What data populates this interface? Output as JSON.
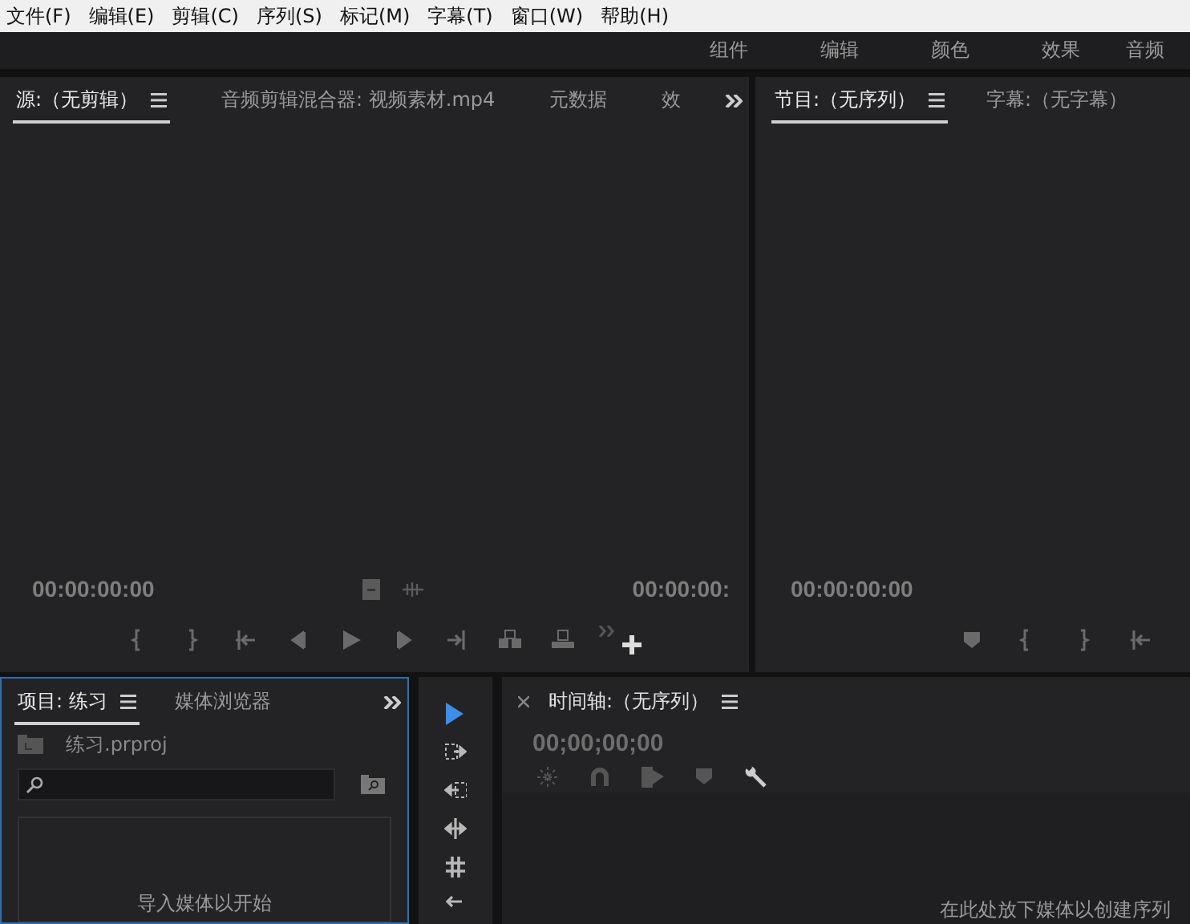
{
  "menu": [
    "文件(F)",
    "编辑(E)",
    "剪辑(C)",
    "序列(S)",
    "标记(M)",
    "字幕(T)",
    "窗口(W)",
    "帮助(H)"
  ],
  "workspaces": [
    "组件",
    "编辑",
    "颜色",
    "效果",
    "音频"
  ],
  "source_monitor": {
    "tabs": [
      {
        "label": "源:（无剪辑）",
        "selected": true
      },
      {
        "label": "音频剪辑混合器: 视频素材.mp4",
        "selected": false
      },
      {
        "label": "元数据",
        "selected": false
      },
      {
        "label": "效",
        "selected": false
      }
    ],
    "timecode_left": "00:00:00:00",
    "timecode_right": "00:00:00:"
  },
  "program_monitor": {
    "tabs": [
      {
        "label": "节目:（无序列）",
        "selected": true
      },
      {
        "label": "字幕:（无字幕）",
        "selected": false
      }
    ],
    "timecode": "00:00:00:00"
  },
  "project": {
    "tabs": [
      {
        "label": "项目: 练习",
        "selected": true
      },
      {
        "label": "媒体浏览器",
        "selected": false
      }
    ],
    "file": "练习.prproj",
    "empty_message": "导入媒体以开始"
  },
  "tools": [
    {
      "kind": "selection",
      "selected": true
    },
    {
      "kind": "track-forward",
      "selected": false
    },
    {
      "kind": "track-backward",
      "selected": false
    },
    {
      "kind": "ripple",
      "selected": false
    },
    {
      "kind": "rolling",
      "selected": false
    }
  ],
  "timeline": {
    "title": "时间轴:（无序列）",
    "timecode": "00;00;00;00",
    "empty_message": "在此处放下媒体以创建序列"
  }
}
